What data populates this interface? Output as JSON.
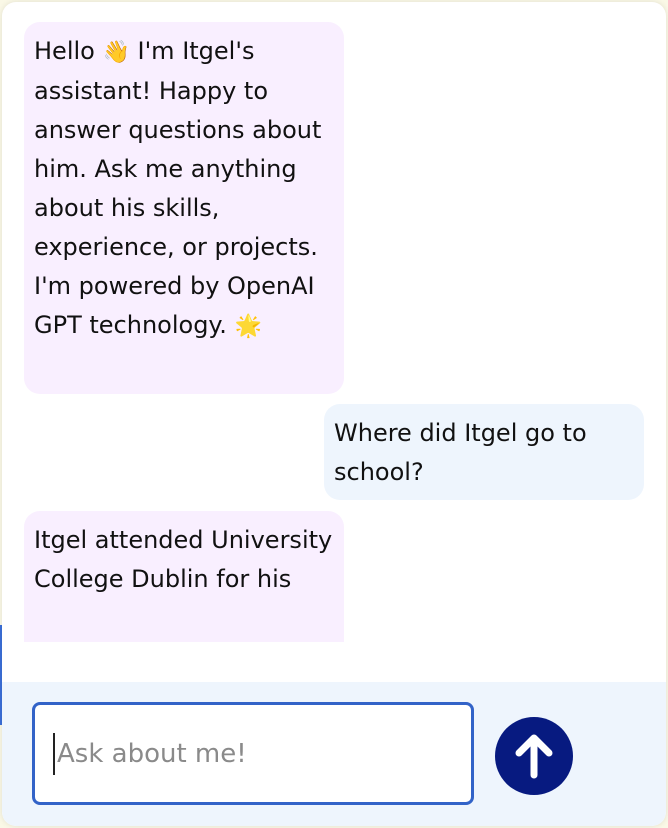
{
  "messages": [
    {
      "role": "assistant",
      "text_part1": "Hello ",
      "emoji1": "👋",
      "text_part2": " I'm Itgel's assistant! Happy to answer questions about him. Ask me anything about his skills, experience, or projects. I'm powered by OpenAI GPT technology. ",
      "emoji2": "🌟"
    },
    {
      "role": "user",
      "text": "Where did Itgel go to school?"
    },
    {
      "role": "assistant",
      "text": "Itgel attended University College Dublin for his"
    }
  ],
  "composer": {
    "placeholder": "Ask about me!",
    "send_icon": "arrow-up-icon"
  },
  "colors": {
    "assistant_bubble": "#f9efff",
    "user_bubble": "#eef5fd",
    "send_button": "#071a80",
    "input_border": "#3263c8"
  }
}
